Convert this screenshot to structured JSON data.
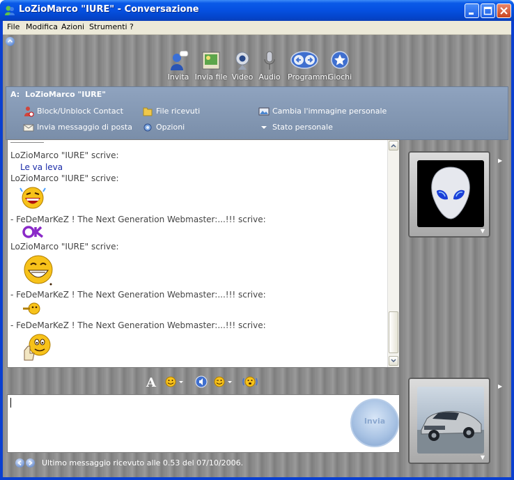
{
  "window": {
    "title": "LoZioMarco \"IURE\" - Conversazione",
    "icon": "msn-buddy-icon"
  },
  "menu": {
    "items": [
      "File",
      "Modifica",
      "Azioni",
      "Strumenti",
      "?"
    ]
  },
  "toolbar": {
    "items": [
      {
        "label": "Invita",
        "icon": "invite-icon"
      },
      {
        "label": "Invia file",
        "icon": "send-file-icon"
      },
      {
        "label": "Video",
        "icon": "webcam-icon"
      },
      {
        "label": "Audio",
        "icon": "microphone-icon"
      },
      {
        "label": "Programmi",
        "icon": "programs-icon"
      },
      {
        "label": "Giochi",
        "icon": "games-icon"
      }
    ]
  },
  "to_panel": {
    "prefix": "A:",
    "contact": "LoZioMarco \"IURE\"",
    "actions": [
      {
        "label": "Block/Unblock Contact",
        "icon": "block-contact-icon"
      },
      {
        "label": "File ricevuti",
        "icon": "folder-icon"
      },
      {
        "label": "Cambia l'immagine personale",
        "icon": "picture-icon"
      },
      {
        "label": "Invia messaggio di posta",
        "icon": "email-icon"
      },
      {
        "label": "Opzioni",
        "icon": "options-icon"
      },
      {
        "label": "Stato personale",
        "icon": "dropdown-arrow-icon"
      }
    ]
  },
  "chat": {
    "messages": [
      {
        "sender_line": "LoZioMarco \"IURE\" scrive:",
        "text": "Le va leva"
      },
      {
        "sender_line": "LoZioMarco \"IURE\" scrive:",
        "emoticon": "laughing-emoticon"
      },
      {
        "sender_line": "- FeDeMarKeZ ! The Next Generation Webmaster:...!!! scrive:",
        "emoticon": "ok-emoticon"
      },
      {
        "sender_line": "LoZioMarco \"IURE\" scrive:",
        "emoticon": "grinning-emoticon"
      },
      {
        "sender_line": "- FeDeMarKeZ ! The Next Generation Webmaster:...!!! scrive:",
        "emoticon": "pointing-emoticon"
      },
      {
        "sender_line": "- FeDeMarKeZ ! The Next Generation Webmaster:...!!! scrive:",
        "emoticon": "thumbs-up-emoticon"
      }
    ]
  },
  "format_bar": {
    "icons": [
      "font-icon",
      "emoticon-picker-icon",
      "voice-clip-icon",
      "wink-icon",
      "nudge-icon"
    ]
  },
  "input": {
    "value": "",
    "send_label": "Invia"
  },
  "status_bar": {
    "text": "Ultimo messaggio ricevuto alle 0.53 del 07/10/2006."
  },
  "colors": {
    "title_bar": "#0a5ae8",
    "message_text": "#1a2ba8",
    "panel_bg": "#8a8a8a"
  }
}
